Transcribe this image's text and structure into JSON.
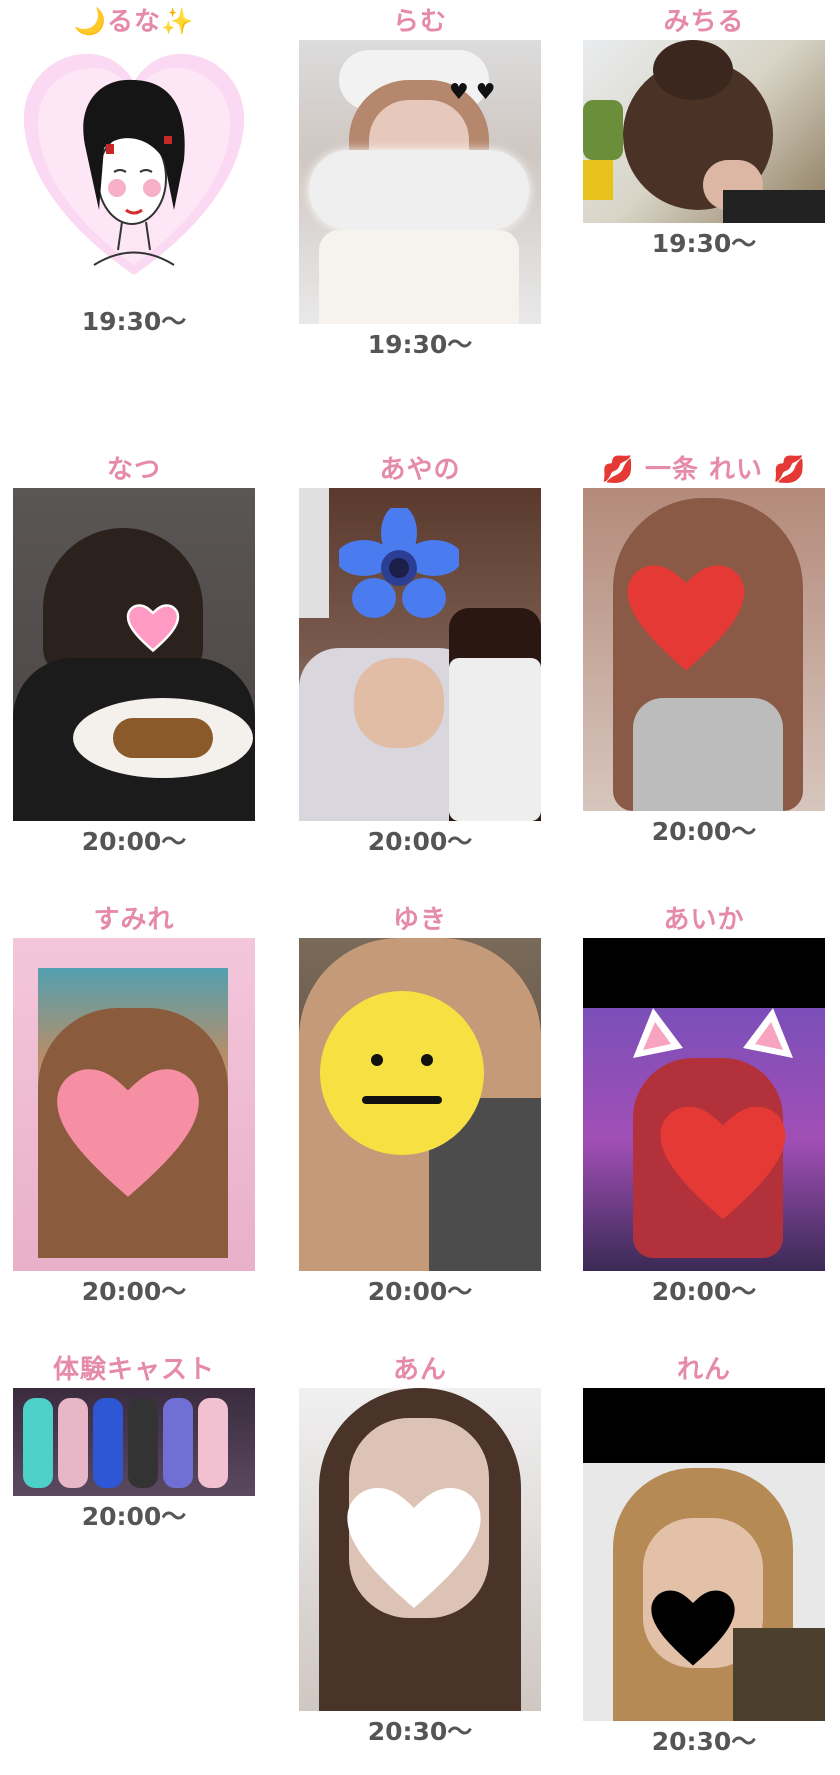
{
  "casts": [
    {
      "name": "るな",
      "name_prefix": "🌙",
      "name_suffix": "✨",
      "time": "19:30〜",
      "photo": "illustrated-woman-avatar"
    },
    {
      "name": "らむ",
      "time": "19:30〜",
      "photo": "cloud-filter-selfie"
    },
    {
      "name": "みちる",
      "time": "19:30〜",
      "photo": "hair-bun-back-view"
    },
    {
      "name": "なつ",
      "time": "20:00〜",
      "photo": "dessert-plate-photo"
    },
    {
      "name": "あやの",
      "time": "20:00〜",
      "photo": "blue-flower-with-bottle"
    },
    {
      "name": "一条 れい",
      "name_prefix": "💋",
      "name_suffix": "💋",
      "time": "20:00〜",
      "photo": "red-heart-peace-sign"
    },
    {
      "name": "すみれ",
      "time": "20:00〜",
      "photo": "pink-heart-cat-ears"
    },
    {
      "name": "ゆき",
      "time": "20:00〜",
      "photo": "yellow-face-sticker"
    },
    {
      "name": "あいか",
      "time": "20:00〜",
      "photo": "cat-ears-red-heart"
    },
    {
      "name": "体験キャスト",
      "time": "20:00〜",
      "photo": "group-photo"
    },
    {
      "name": "あん",
      "time": "20:30〜",
      "photo": "white-heart-selfie"
    },
    {
      "name": "れん",
      "time": "20:30〜",
      "photo": "black-heart-blonde"
    }
  ],
  "colors": {
    "name": "#e58aaa",
    "time": "#555555"
  }
}
